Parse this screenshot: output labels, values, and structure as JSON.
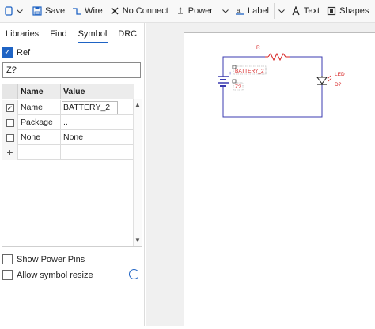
{
  "toolbar": {
    "save_label": "Save",
    "wire_label": "Wire",
    "noconnect_label": "No Connect",
    "power_label": "Power",
    "label_label": "Label",
    "text_label": "Text",
    "shapes_label": "Shapes"
  },
  "tabs": [
    {
      "label": "Libraries"
    },
    {
      "label": "Find"
    },
    {
      "label": "Symbol"
    },
    {
      "label": "DRC"
    }
  ],
  "active_tab": "Symbol",
  "ref": {
    "label": "Ref",
    "checked": true
  },
  "search": {
    "value": "Z?"
  },
  "grid": {
    "headers": [
      "Name",
      "Value"
    ],
    "rows": [
      {
        "checked": true,
        "name": "Name",
        "value": "BATTERY_2"
      },
      {
        "checked": false,
        "name": "Package",
        "value": ".."
      },
      {
        "checked": false,
        "name": "None",
        "value": "None"
      }
    ],
    "add_symbol": "+"
  },
  "options": {
    "show_power_pins": "Show Power Pins",
    "allow_resize": "Allow symbol resize"
  },
  "schematic": {
    "resistor_label": "R",
    "battery_label": "BATTERY_2",
    "battery_ref": "Z?",
    "led_label": "LED",
    "led_ref": "D?",
    "battery_plus": "+",
    "wire_color": "#3b3bb0",
    "component_color": "#d62020"
  },
  "colors": {
    "accent": "#1e63c4"
  }
}
